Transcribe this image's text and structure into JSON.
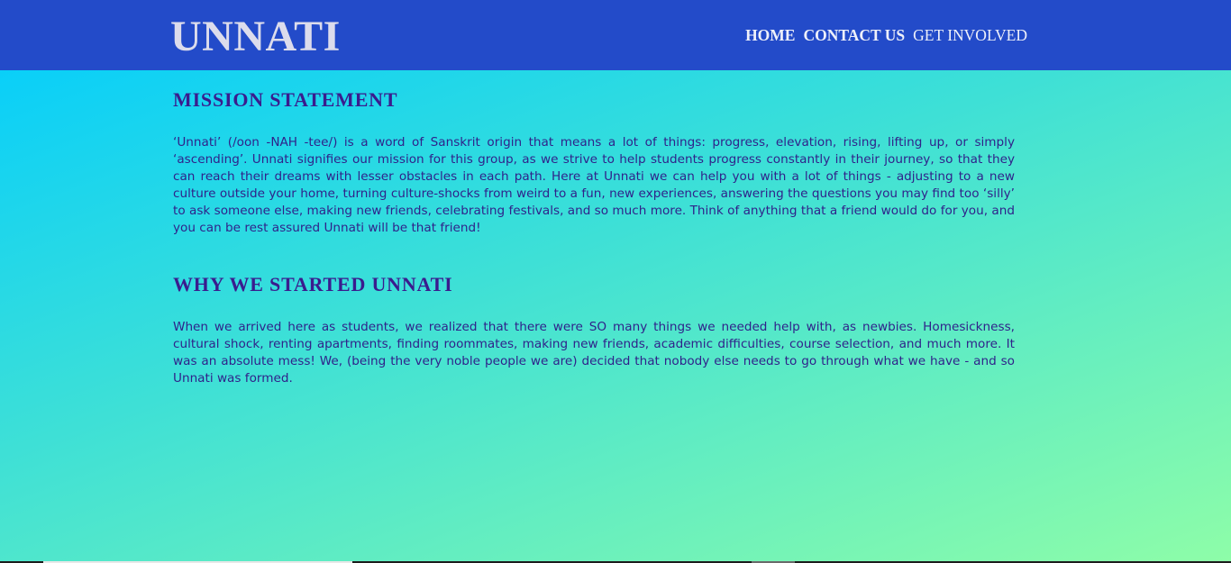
{
  "header": {
    "brand": "UNNATI",
    "nav": [
      {
        "label": "HOME"
      },
      {
        "label": "CONTACT US"
      },
      {
        "label": "GET INVOLVED"
      }
    ],
    "background_color": "#234bc9"
  },
  "sections": [
    {
      "title": "MISSION STATEMENT",
      "body": "‘Unnati’ (/oon -NAH -tee/) is a word of Sanskrit origin that means a lot of things: progress, elevation, rising, lifting up, or simply ‘ascending’. Unnati signifies our mission for this group, as we strive to help students progress constantly in their journey, so that they can reach their dreams with lesser obstacles in each path. Here at Unnati we can help you with a lot of things - adjusting to a new culture outside your home, turning culture-shocks from weird to a fun, new experiences, answering the questions you may find too ‘silly’ to ask someone else, making new friends, celebrating festivals, and so much more. Think of anything that a friend would do for you, and you can be rest assured Unnati will be that friend!"
    },
    {
      "title": "WHY WE STARTED UNNATI",
      "body": "When we arrived here as students, we realized that there were SO many things we needed help with, as newbies. Homesickness, cultural shock, renting apartments, finding roommates, making new friends, academic difficulties, course selection, and much more. It was an absolute mess! We, (being the very noble people we are) decided that nobody else needs to go through what we have - and so Unnati was formed."
    }
  ],
  "colors": {
    "heading": "#3a1c8e",
    "text": "#30228a",
    "gradient_start": "#00ccff",
    "gradient_end": "#8efda8"
  }
}
